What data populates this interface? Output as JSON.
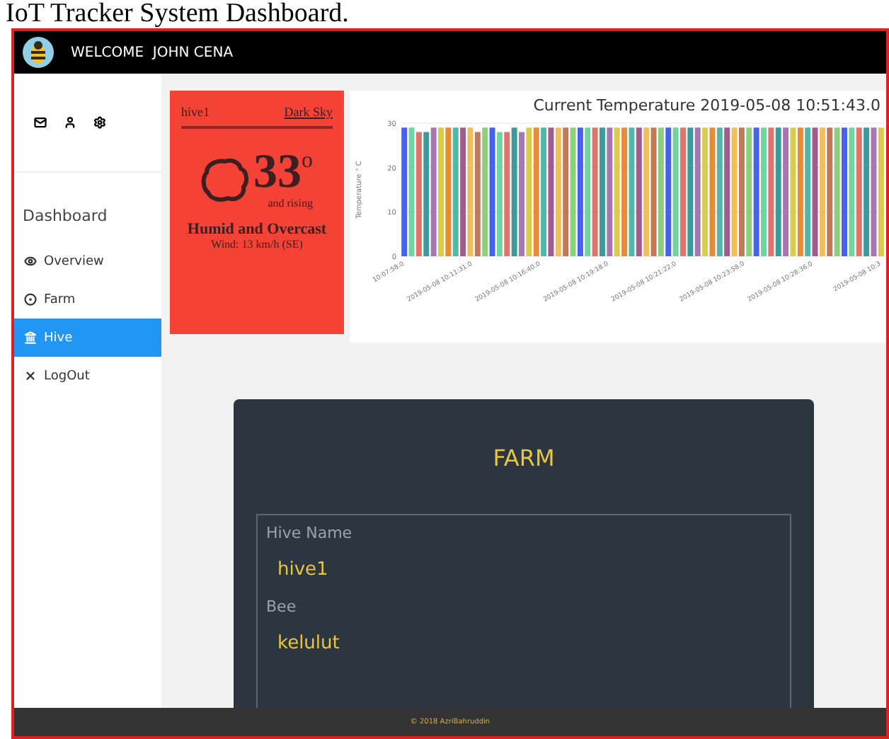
{
  "caption": "IoT Tracker System Dashboard.",
  "header": {
    "welcome": "WELCOME  JOHN CENA"
  },
  "sidebar": {
    "heading": "Dashboard",
    "items": [
      {
        "label": "Overview",
        "kind": "eye",
        "selected": false
      },
      {
        "label": "Farm",
        "kind": "dot",
        "selected": false
      },
      {
        "label": "Hive",
        "kind": "building",
        "selected": true
      },
      {
        "label": "LogOut",
        "kind": "close",
        "selected": false
      }
    ]
  },
  "weather": {
    "hive": "hive1",
    "source": "Dark Sky",
    "temperature": "33",
    "unit": "o",
    "trend": "and rising",
    "summary": "Humid and Overcast",
    "wind": "Wind: 13 km/h (SE)"
  },
  "chart": {
    "chart_data": {
      "type": "bar",
      "title": "Current Temperature 2019-05-08 10:51:43.0",
      "ylabel": "Temperature ° C",
      "yticks": [
        0,
        10,
        20,
        30
      ],
      "ylim": [
        0,
        30
      ],
      "series": [
        {
          "values": [
            29,
            29,
            28,
            28,
            29,
            29,
            29,
            29,
            29,
            29,
            28,
            29,
            29,
            28,
            28,
            29,
            28,
            29,
            29,
            29,
            29,
            29,
            29,
            29,
            29,
            29,
            29,
            29,
            29,
            29,
            29,
            29,
            29,
            29,
            29,
            29,
            29,
            29,
            29,
            29,
            29,
            29,
            29,
            29,
            29,
            29,
            29,
            29,
            29,
            29,
            29,
            29,
            29,
            29,
            29,
            29,
            29,
            29,
            29,
            29,
            29,
            29,
            29,
            29,
            29,
            29
          ]
        }
      ]
    },
    "x_axis_labels": [
      "10:07:58.0",
      "2019-05-08 10:11:31.0",
      "2019-05-08 10:16:40.0",
      "2019-05-08 10:19:18.0",
      "2019-05-08 10:21:22.0",
      "2019-05-08 10:23:58.0",
      "2019-05-08 10:28:36.0",
      "2019-05-08 10:3"
    ]
  },
  "farm": {
    "title": "FARM",
    "fields": [
      {
        "label": "Hive Name",
        "value": "hive1"
      },
      {
        "label": "Bee",
        "value": "kelulut"
      }
    ]
  },
  "footer": "© 2018 AzriBahruddin"
}
